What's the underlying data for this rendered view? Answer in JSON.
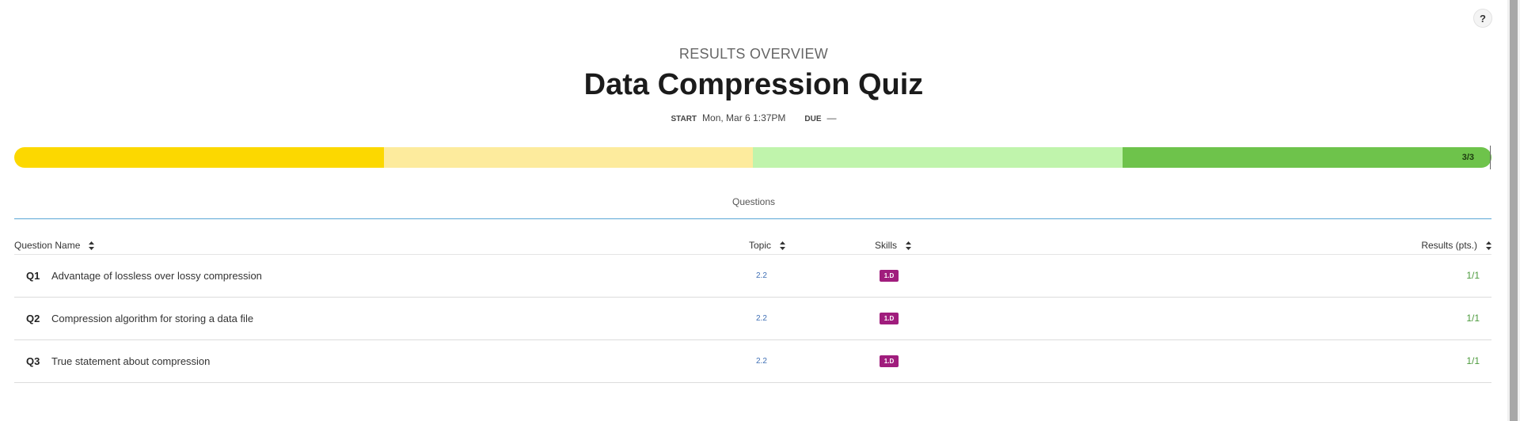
{
  "help": {
    "label": "?"
  },
  "header": {
    "overview_label": "RESULTS OVERVIEW",
    "title": "Data Compression Quiz",
    "start_label": "START",
    "start_value": "Mon, Mar 6 1:37PM",
    "due_label": "DUE",
    "due_value": "—"
  },
  "progress": {
    "score_text": "3/3",
    "fraction": 1.0,
    "segment_colors": [
      "#fcd800",
      "#fdeb9d",
      "#c0f4ac",
      "#6ec34b"
    ]
  },
  "section": {
    "title": "Questions"
  },
  "table": {
    "columns": {
      "name": "Question Name",
      "topic": "Topic",
      "skills": "Skills",
      "results": "Results (pts.)"
    },
    "rows": [
      {
        "id": "Q1",
        "name": "Advantage of lossless over lossy compression",
        "topic": "2.2",
        "skill": "1.D",
        "result": "1/1"
      },
      {
        "id": "Q2",
        "name": "Compression algorithm for storing a data file",
        "topic": "2.2",
        "skill": "1.D",
        "result": "1/1"
      },
      {
        "id": "Q3",
        "name": "True statement about compression",
        "topic": "2.2",
        "skill": "1.D",
        "result": "1/1"
      }
    ]
  },
  "colors": {
    "skill_badge": "#a01d7d",
    "topic_link": "#3f6fb5",
    "result_text": "#4c9a3c",
    "section_rule": "#5aa7d6"
  }
}
